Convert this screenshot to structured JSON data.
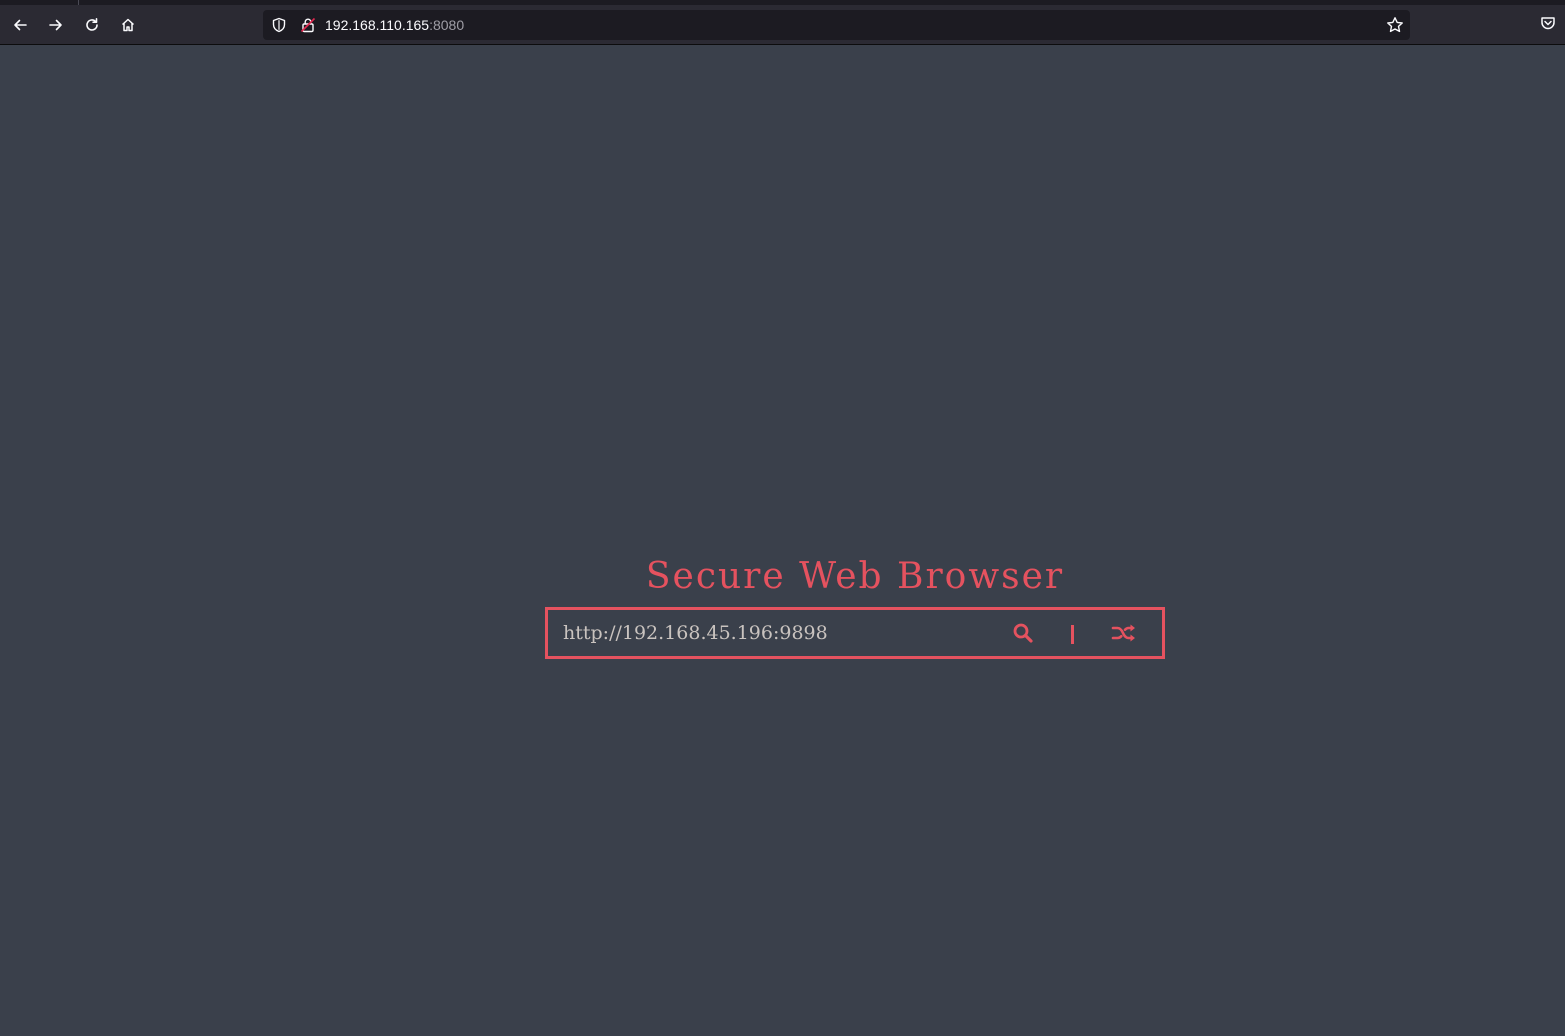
{
  "browser": {
    "url_host": "192.168.110.165",
    "url_port": ":8080",
    "icons": {
      "back": "back-arrow-icon",
      "forward": "forward-arrow-icon",
      "reload": "reload-icon",
      "home": "home-icon",
      "tracking": "shield-icon",
      "security": "lock-icon",
      "bookmark": "star-icon",
      "pocket": "pocket-icon"
    }
  },
  "page": {
    "title": "Secure Web Browser",
    "input_value": "http://192.168.45.196:9898",
    "icons": {
      "search": "search-icon",
      "random": "shuffle-icon"
    },
    "accent": "#e5525f",
    "background": "#3a404b"
  }
}
